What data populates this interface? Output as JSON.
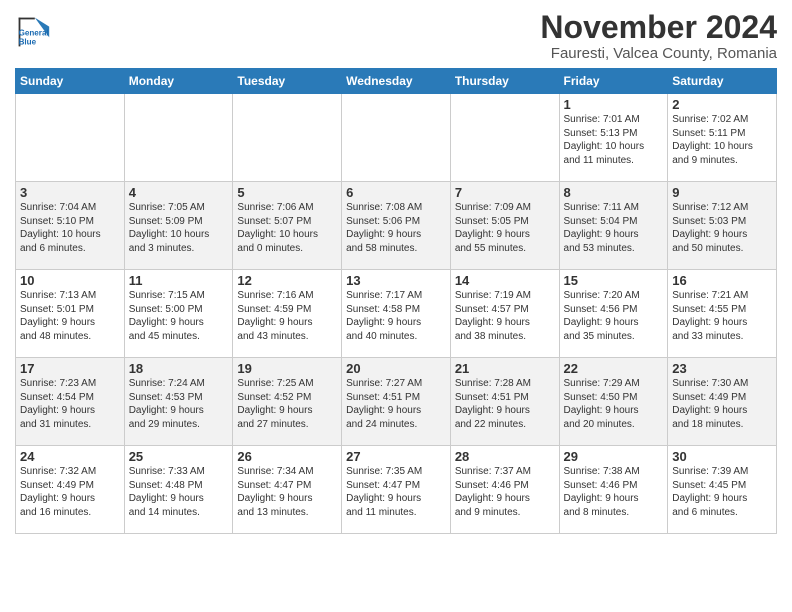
{
  "header": {
    "logo_line1": "General",
    "logo_line2": "Blue",
    "title": "November 2024",
    "subtitle": "Fauresti, Valcea County, Romania"
  },
  "weekdays": [
    "Sunday",
    "Monday",
    "Tuesday",
    "Wednesday",
    "Thursday",
    "Friday",
    "Saturday"
  ],
  "weeks": [
    [
      {
        "day": "",
        "info": ""
      },
      {
        "day": "",
        "info": ""
      },
      {
        "day": "",
        "info": ""
      },
      {
        "day": "",
        "info": ""
      },
      {
        "day": "",
        "info": ""
      },
      {
        "day": "1",
        "info": "Sunrise: 7:01 AM\nSunset: 5:13 PM\nDaylight: 10 hours\nand 11 minutes."
      },
      {
        "day": "2",
        "info": "Sunrise: 7:02 AM\nSunset: 5:11 PM\nDaylight: 10 hours\nand 9 minutes."
      }
    ],
    [
      {
        "day": "3",
        "info": "Sunrise: 7:04 AM\nSunset: 5:10 PM\nDaylight: 10 hours\nand 6 minutes."
      },
      {
        "day": "4",
        "info": "Sunrise: 7:05 AM\nSunset: 5:09 PM\nDaylight: 10 hours\nand 3 minutes."
      },
      {
        "day": "5",
        "info": "Sunrise: 7:06 AM\nSunset: 5:07 PM\nDaylight: 10 hours\nand 0 minutes."
      },
      {
        "day": "6",
        "info": "Sunrise: 7:08 AM\nSunset: 5:06 PM\nDaylight: 9 hours\nand 58 minutes."
      },
      {
        "day": "7",
        "info": "Sunrise: 7:09 AM\nSunset: 5:05 PM\nDaylight: 9 hours\nand 55 minutes."
      },
      {
        "day": "8",
        "info": "Sunrise: 7:11 AM\nSunset: 5:04 PM\nDaylight: 9 hours\nand 53 minutes."
      },
      {
        "day": "9",
        "info": "Sunrise: 7:12 AM\nSunset: 5:03 PM\nDaylight: 9 hours\nand 50 minutes."
      }
    ],
    [
      {
        "day": "10",
        "info": "Sunrise: 7:13 AM\nSunset: 5:01 PM\nDaylight: 9 hours\nand 48 minutes."
      },
      {
        "day": "11",
        "info": "Sunrise: 7:15 AM\nSunset: 5:00 PM\nDaylight: 9 hours\nand 45 minutes."
      },
      {
        "day": "12",
        "info": "Sunrise: 7:16 AM\nSunset: 4:59 PM\nDaylight: 9 hours\nand 43 minutes."
      },
      {
        "day": "13",
        "info": "Sunrise: 7:17 AM\nSunset: 4:58 PM\nDaylight: 9 hours\nand 40 minutes."
      },
      {
        "day": "14",
        "info": "Sunrise: 7:19 AM\nSunset: 4:57 PM\nDaylight: 9 hours\nand 38 minutes."
      },
      {
        "day": "15",
        "info": "Sunrise: 7:20 AM\nSunset: 4:56 PM\nDaylight: 9 hours\nand 35 minutes."
      },
      {
        "day": "16",
        "info": "Sunrise: 7:21 AM\nSunset: 4:55 PM\nDaylight: 9 hours\nand 33 minutes."
      }
    ],
    [
      {
        "day": "17",
        "info": "Sunrise: 7:23 AM\nSunset: 4:54 PM\nDaylight: 9 hours\nand 31 minutes."
      },
      {
        "day": "18",
        "info": "Sunrise: 7:24 AM\nSunset: 4:53 PM\nDaylight: 9 hours\nand 29 minutes."
      },
      {
        "day": "19",
        "info": "Sunrise: 7:25 AM\nSunset: 4:52 PM\nDaylight: 9 hours\nand 27 minutes."
      },
      {
        "day": "20",
        "info": "Sunrise: 7:27 AM\nSunset: 4:51 PM\nDaylight: 9 hours\nand 24 minutes."
      },
      {
        "day": "21",
        "info": "Sunrise: 7:28 AM\nSunset: 4:51 PM\nDaylight: 9 hours\nand 22 minutes."
      },
      {
        "day": "22",
        "info": "Sunrise: 7:29 AM\nSunset: 4:50 PM\nDaylight: 9 hours\nand 20 minutes."
      },
      {
        "day": "23",
        "info": "Sunrise: 7:30 AM\nSunset: 4:49 PM\nDaylight: 9 hours\nand 18 minutes."
      }
    ],
    [
      {
        "day": "24",
        "info": "Sunrise: 7:32 AM\nSunset: 4:49 PM\nDaylight: 9 hours\nand 16 minutes."
      },
      {
        "day": "25",
        "info": "Sunrise: 7:33 AM\nSunset: 4:48 PM\nDaylight: 9 hours\nand 14 minutes."
      },
      {
        "day": "26",
        "info": "Sunrise: 7:34 AM\nSunset: 4:47 PM\nDaylight: 9 hours\nand 13 minutes."
      },
      {
        "day": "27",
        "info": "Sunrise: 7:35 AM\nSunset: 4:47 PM\nDaylight: 9 hours\nand 11 minutes."
      },
      {
        "day": "28",
        "info": "Sunrise: 7:37 AM\nSunset: 4:46 PM\nDaylight: 9 hours\nand 9 minutes."
      },
      {
        "day": "29",
        "info": "Sunrise: 7:38 AM\nSunset: 4:46 PM\nDaylight: 9 hours\nand 8 minutes."
      },
      {
        "day": "30",
        "info": "Sunrise: 7:39 AM\nSunset: 4:45 PM\nDaylight: 9 hours\nand 6 minutes."
      }
    ]
  ]
}
